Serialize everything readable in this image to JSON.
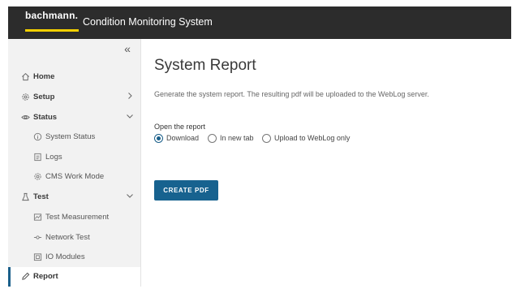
{
  "header": {
    "logo_text": "bachmann.",
    "app_title": "Condition Monitoring System",
    "accent": "#f4d000"
  },
  "sidebar": {
    "collapse_glyph": "«",
    "items": [
      {
        "label": "Home",
        "icon": "home-icon"
      },
      {
        "label": "Setup",
        "icon": "gear-icon"
      },
      {
        "label": "Status",
        "icon": "eye-icon"
      },
      {
        "label": "System Status",
        "icon": "info-icon"
      },
      {
        "label": "Logs",
        "icon": "document-icon"
      },
      {
        "label": "CMS Work Mode",
        "icon": "gear-icon"
      },
      {
        "label": "Test",
        "icon": "flask-icon"
      },
      {
        "label": "Test Measurement",
        "icon": "chart-icon"
      },
      {
        "label": "Network Test",
        "icon": "network-icon"
      },
      {
        "label": "IO Modules",
        "icon": "module-icon"
      },
      {
        "label": "Report",
        "icon": "pencil-icon"
      }
    ]
  },
  "main": {
    "title": "System Report",
    "description": "Generate the system report. The resulting pdf will be uploaded to the WebLog server.",
    "open_label": "Open the report",
    "options": [
      "Download",
      "In new tab",
      "Upload to WebLog only"
    ],
    "selected_option": "Download",
    "button_label": "CREATE PDF",
    "button_color": "#17628f"
  }
}
